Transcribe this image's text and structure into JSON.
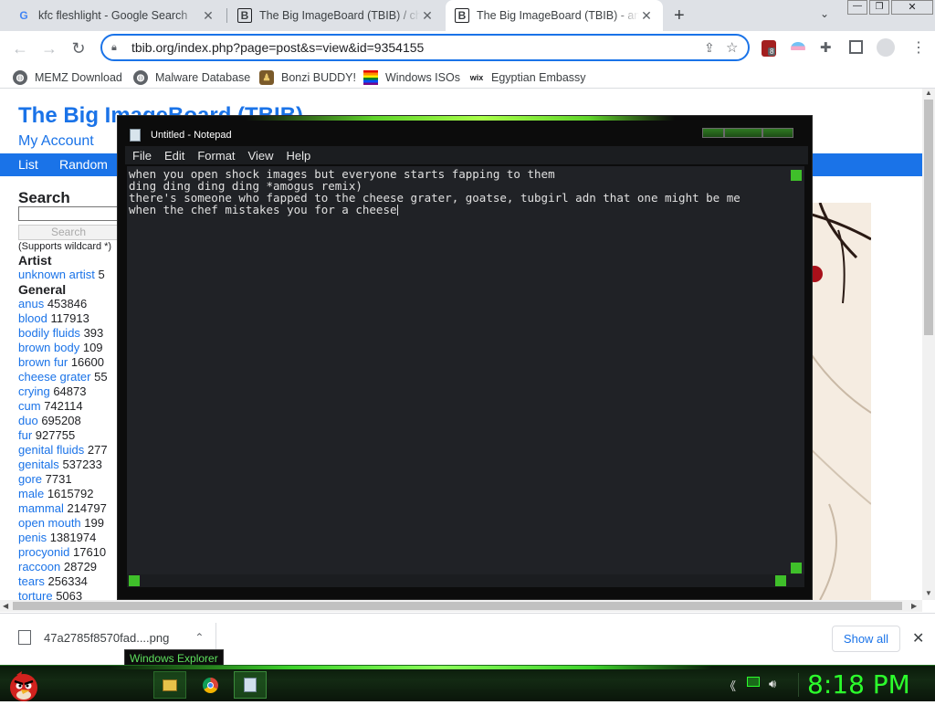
{
  "browser": {
    "tabs": [
      {
        "title": "kfc fleshlight - Google Search",
        "favicon": "G",
        "active": false
      },
      {
        "title": "The Big ImageBoard (TBIB) / cheese grater",
        "favicon": "B",
        "active": false
      },
      {
        "title": "The Big ImageBoard (TBIB) - anus",
        "favicon": "B",
        "active": true
      }
    ],
    "new_tab": "+",
    "url": "tbib.org/index.php?page=post&s=view&id=9354155",
    "extension_badge": "8",
    "bookmarks": [
      {
        "label": "MEMZ Download",
        "icon": "globe-icon"
      },
      {
        "label": "Malware Database",
        "icon": "globe-icon"
      },
      {
        "label": "Bonzi BUDDY!",
        "icon": "bonzi-icon"
      },
      {
        "label": "Windows ISOs",
        "icon": "rainbow-flag-icon"
      },
      {
        "label": "Egyptian Embassy",
        "icon": "wix-icon"
      }
    ]
  },
  "site": {
    "title": "The Big ImageBoard (TBIB)",
    "my_account": "My Account",
    "nav": [
      "List",
      "Random"
    ],
    "search_heading": "Search",
    "search_button": "Search",
    "wildcard_note": "(Supports wildcard *)",
    "artist_heading": "Artist",
    "artist": {
      "name": "unknown artist",
      "count": "5"
    },
    "general_heading": "General",
    "tags": [
      {
        "name": "anus",
        "count": "453846"
      },
      {
        "name": "blood",
        "count": "117913"
      },
      {
        "name": "bodily fluids",
        "count": "393"
      },
      {
        "name": "brown body",
        "count": "109"
      },
      {
        "name": "brown fur",
        "count": "16600"
      },
      {
        "name": "cheese grater",
        "count": "55"
      },
      {
        "name": "crying",
        "count": "64873"
      },
      {
        "name": "cum",
        "count": "742114"
      },
      {
        "name": "duo",
        "count": "695208"
      },
      {
        "name": "fur",
        "count": "927755"
      },
      {
        "name": "genital fluids",
        "count": "277"
      },
      {
        "name": "genitals",
        "count": "537233"
      },
      {
        "name": "gore",
        "count": "7731"
      },
      {
        "name": "male",
        "count": "1615792"
      },
      {
        "name": "mammal",
        "count": "214797"
      },
      {
        "name": "open mouth",
        "count": "199"
      },
      {
        "name": "penis",
        "count": "1381974"
      },
      {
        "name": "procyonid",
        "count": "17610"
      },
      {
        "name": "raccoon",
        "count": "28729"
      },
      {
        "name": "tears",
        "count": "256334"
      },
      {
        "name": "torture",
        "count": "5063"
      }
    ]
  },
  "download": {
    "filename": "47a2785f8570fad....png",
    "show_all": "Show all"
  },
  "notepad": {
    "title": "Untitled - Notepad",
    "menu": [
      "File",
      "Edit",
      "Format",
      "View",
      "Help"
    ],
    "lines": [
      "when you open shock images but everyone starts fapping to them",
      "ding ding ding ding *amogus remix)",
      "there's someone who fapped to the cheese grater, goatse, tubgirl adn that one might be me",
      "when the chef mistakes you for a cheese"
    ]
  },
  "taskbar": {
    "tooltip": "Windows Explorer",
    "clock": "8:18 PM"
  },
  "colors": {
    "accent": "#1a73e8",
    "theme_green": "#3cd12a"
  }
}
